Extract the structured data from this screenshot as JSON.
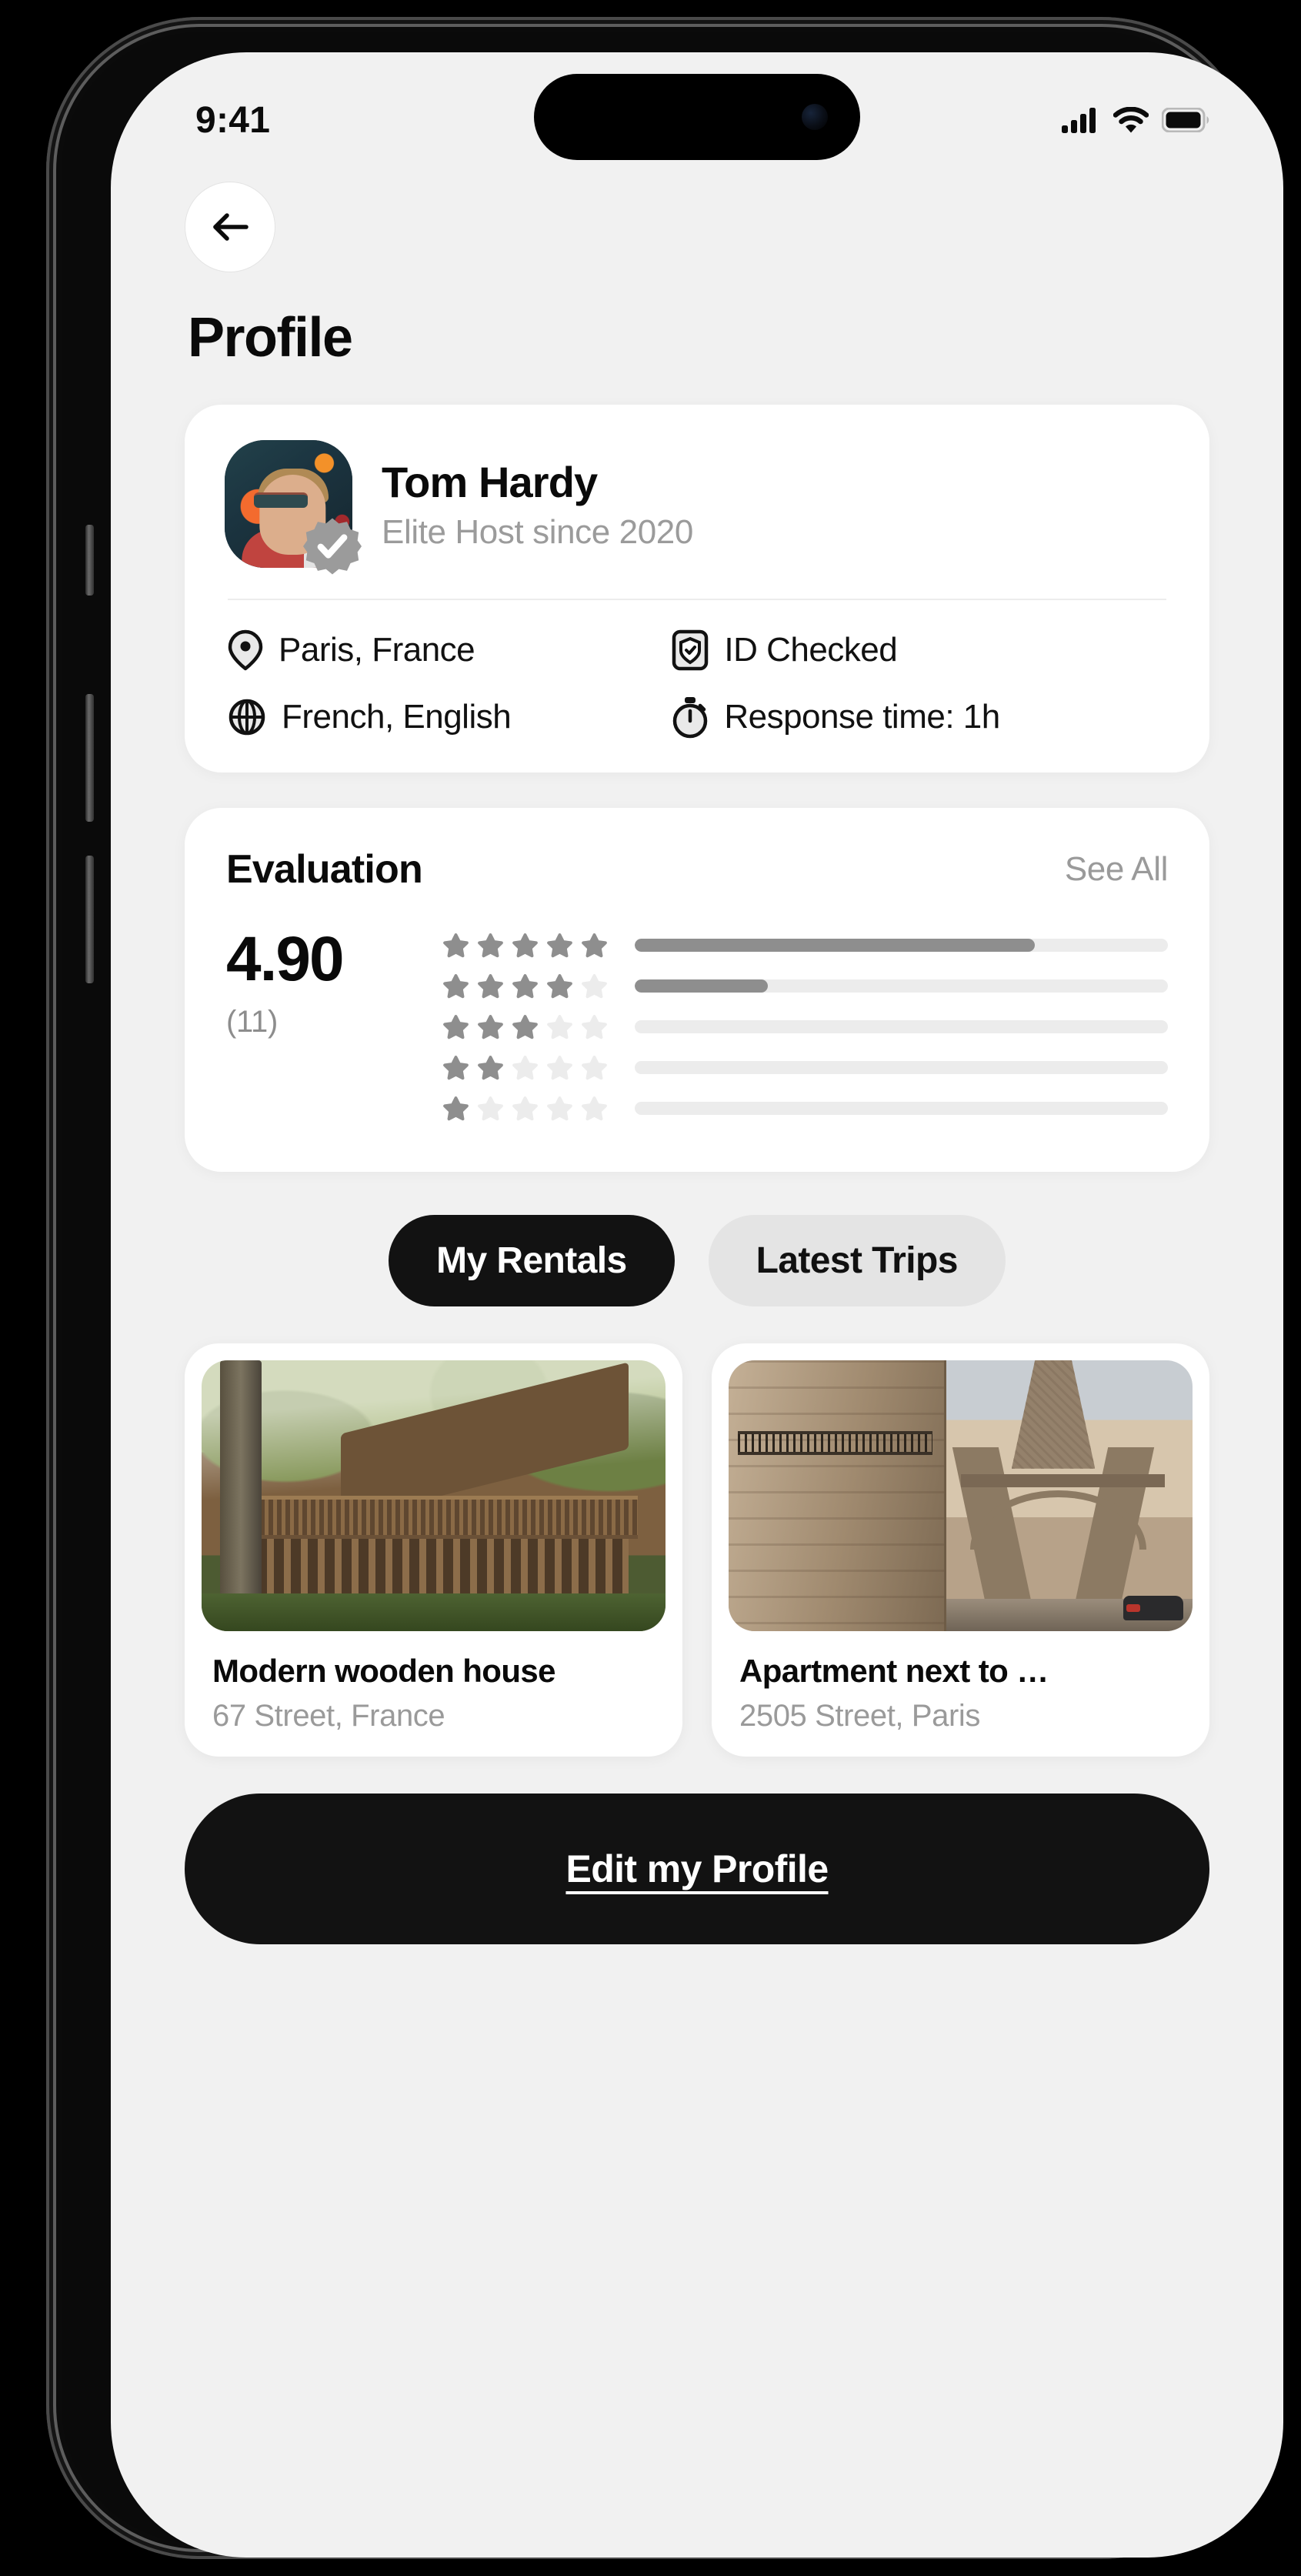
{
  "status_bar": {
    "time": "9:41",
    "icons": [
      "cellular-signal-icon",
      "wifi-icon",
      "battery-icon"
    ]
  },
  "header": {
    "back_icon": "arrow-left-icon",
    "title": "Profile"
  },
  "profile": {
    "name": "Tom Hardy",
    "subtitle": "Elite Host since 2020",
    "avatar_alt": "avatar",
    "verified_icon": "verified-badge-icon",
    "details": [
      {
        "icon": "location-pin-icon",
        "label": "Paris, France"
      },
      {
        "icon": "id-check-icon",
        "label": "ID Checked"
      },
      {
        "icon": "globe-icon",
        "label": "French, English"
      },
      {
        "icon": "stopwatch-icon",
        "label": "Response time: 1h"
      }
    ]
  },
  "evaluation": {
    "title": "Evaluation",
    "see_all": "See All",
    "score": "4.90",
    "count": "(11)",
    "star_filled_color": "#8e8e8e",
    "star_empty_color": "#ececec",
    "bar_fill_color": "#8e8e8e",
    "bar_track_color": "#ececec",
    "rows": [
      {
        "stars": 5,
        "percent": 75
      },
      {
        "stars": 4,
        "percent": 25
      },
      {
        "stars": 3,
        "percent": 0
      },
      {
        "stars": 2,
        "percent": 0
      },
      {
        "stars": 1,
        "percent": 0
      }
    ]
  },
  "tabs": [
    {
      "label": "My Rentals",
      "active": true
    },
    {
      "label": "Latest Trips",
      "active": false
    }
  ],
  "listings": [
    {
      "title": "Modern wooden house",
      "address": "67 Street, France",
      "photo": "wooden-house-photo"
    },
    {
      "title": "Apartment next to …",
      "address": "2505 Street, Paris",
      "photo": "eiffel-tower-photo"
    }
  ],
  "footer": {
    "edit_profile_label": "Edit my Profile"
  },
  "colors": {
    "screen_background": "#f1f1f1",
    "card_background": "#ffffff",
    "primary_text": "#0a0a0a",
    "secondary_text": "#9a9a9a",
    "accent_dark": "#121212",
    "tab_inactive": "#e4e4e4"
  }
}
